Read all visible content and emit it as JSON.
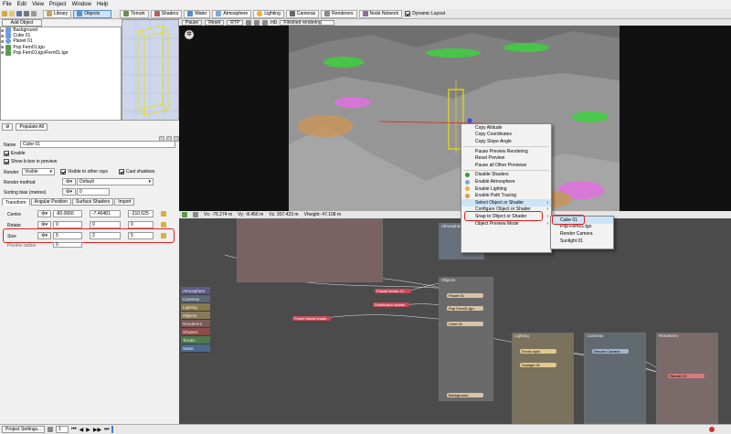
{
  "menu": [
    "File",
    "Edit",
    "View",
    "Project",
    "Window",
    "Help"
  ],
  "toolbar": {
    "tabs": [
      "Library",
      "Objects",
      "Terrain",
      "Shaders",
      "Water",
      "Atmosphere",
      "Lighting",
      "Cameras",
      "Renderers",
      "Node Network"
    ],
    "dynamic_layout": "Dynamic Layout"
  },
  "add_object": "Add Object",
  "tree_items": [
    "Background",
    "Cube 01",
    "Planet 01",
    "Pop Fern01.tgo",
    "Pop Fern01.tgo/Fern01.tgo"
  ],
  "populate": "Populate All",
  "props": {
    "name_label": "Name",
    "name_value": "Cube 01",
    "enable": "Enable",
    "show_bbox": "Show b-box in preview",
    "render_label": "Render",
    "render_value": "Visible",
    "visible_other": "Visible to other rays",
    "cast_shadows": "Cast shadows",
    "render_method_label": "Render method",
    "render_method_value": "Default",
    "sorting_bias_label": "Sorting bias (metres)",
    "sorting_bias_value": "0",
    "tabs": [
      "Transform",
      "Angular Position",
      "Surface Shaders",
      "Import"
    ],
    "centre_label": "Centre",
    "centre": [
      "-80.0666",
      "-7.46481",
      "-310.625"
    ],
    "rotate_label": "Rotate",
    "rotate": [
      "0",
      "0",
      "0"
    ],
    "size_label": "Size",
    "size": [
      "5",
      "2",
      "5"
    ],
    "pivot_label": "Pivot/w radius",
    "pivot_value": "0"
  },
  "render_bar": {
    "pause": "Pause",
    "reset": "Reset",
    "rtp": "RTP",
    "hd": "HD",
    "status": "Finished rendering"
  },
  "status": {
    "x": "Vx: -76.274 m",
    "y": "Vy: -8.456 m",
    "z": "Vz: 307.423 m",
    "height": "Vheight: 47.108 m"
  },
  "context_menu": [
    "Copy Altitude",
    "Copy Coordinates",
    "Copy Slope Angle",
    "Pause Preview Rendering",
    "Reset Preview",
    "Pause all Other Previews",
    "Disable Shaders",
    "Enable Atmosphere",
    "Enable Lighting",
    "Enable Path Tracing",
    "Select Object or Shader",
    "Configure Object or Shader",
    "Snap to Object or Shader",
    "Object Preview Mode"
  ],
  "submenu": [
    "Cube 01",
    "Pop Fern01.tgo",
    "Render Camera",
    "Sunlight 01"
  ],
  "legend": [
    "Atmosphere",
    "Cameras",
    "Lighting",
    "Objects",
    "Renderers",
    "Shaders",
    "Terrain",
    "Water"
  ],
  "nodes": {
    "atmosphere": "Atmosphere",
    "objects": "Objects",
    "planet": "Planet 01",
    "pop": "Pop Fern01.tgo",
    "cube": "Cube 01",
    "background": "Background",
    "lighting": "Lighting",
    "enviro": "Enviro light",
    "sunlight": "Sunlight 01",
    "cameras": "Cameras",
    "render_camera": "Render Camera",
    "renderers": "Renderers",
    "render01": "Render 01",
    "fractal1": "Fractal terrain 01",
    "displacement": "Distribution shader",
    "fractal2": "Power fractal shade"
  },
  "bottom": {
    "project_settings": "Project Settings...",
    "frame": "1"
  },
  "colors": {
    "highlight": "#e02020",
    "menu_highlight": "#cce4f7"
  }
}
